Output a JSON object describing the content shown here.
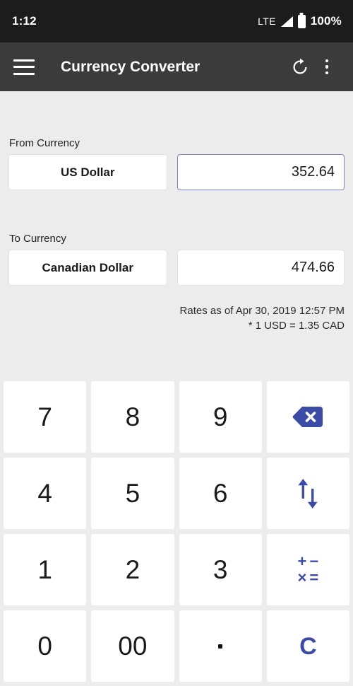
{
  "status_bar": {
    "time": "1:12",
    "network_label": "LTE",
    "battery_percent": "100%",
    "signal_icon": "signal-triangle-icon",
    "battery_icon": "battery-full-icon"
  },
  "app_bar": {
    "menu_icon": "hamburger-menu-icon",
    "title": "Currency Converter",
    "refresh_icon": "refresh-icon",
    "overflow_icon": "overflow-menu-icon",
    "background_color": "#3b3b3b"
  },
  "from_section": {
    "label": "From Currency",
    "currency": "US Dollar",
    "amount": "352.64",
    "amount_focused": true
  },
  "to_section": {
    "label": "To Currency",
    "currency": "Canadian Dollar",
    "amount": "474.66",
    "amount_focused": false
  },
  "rates": {
    "line1": "Rates as of Apr 30, 2019 12:57 PM",
    "line2": "* 1 USD = 1.35 CAD"
  },
  "keypad": {
    "keys": [
      {
        "label": "7",
        "type": "digit",
        "name": "key-7"
      },
      {
        "label": "8",
        "type": "digit",
        "name": "key-8"
      },
      {
        "label": "9",
        "type": "digit",
        "name": "key-9"
      },
      {
        "label": "",
        "type": "backspace",
        "name": "backspace-key"
      },
      {
        "label": "4",
        "type": "digit",
        "name": "key-4"
      },
      {
        "label": "5",
        "type": "digit",
        "name": "key-5"
      },
      {
        "label": "6",
        "type": "digit",
        "name": "key-6"
      },
      {
        "label": "",
        "type": "swap",
        "name": "swap-currencies-key"
      },
      {
        "label": "1",
        "type": "digit",
        "name": "key-1"
      },
      {
        "label": "2",
        "type": "digit",
        "name": "key-2"
      },
      {
        "label": "3",
        "type": "digit",
        "name": "key-3"
      },
      {
        "label": "",
        "type": "math",
        "name": "math-operators-key"
      },
      {
        "label": "0",
        "type": "digit",
        "name": "key-0"
      },
      {
        "label": "00",
        "type": "digit",
        "name": "key-double-zero"
      },
      {
        "label": ".",
        "type": "dot",
        "name": "key-decimal-point"
      },
      {
        "label": "C",
        "type": "clear",
        "name": "clear-key"
      }
    ],
    "math_symbols": [
      "+",
      "−",
      "×",
      "="
    ]
  },
  "colors": {
    "accent_blue": "#3c4ba6",
    "background": "#ececec",
    "key_surface": "#ffffff",
    "focus_border": "#7c85c0",
    "status_bar": "#1c1c1c"
  }
}
